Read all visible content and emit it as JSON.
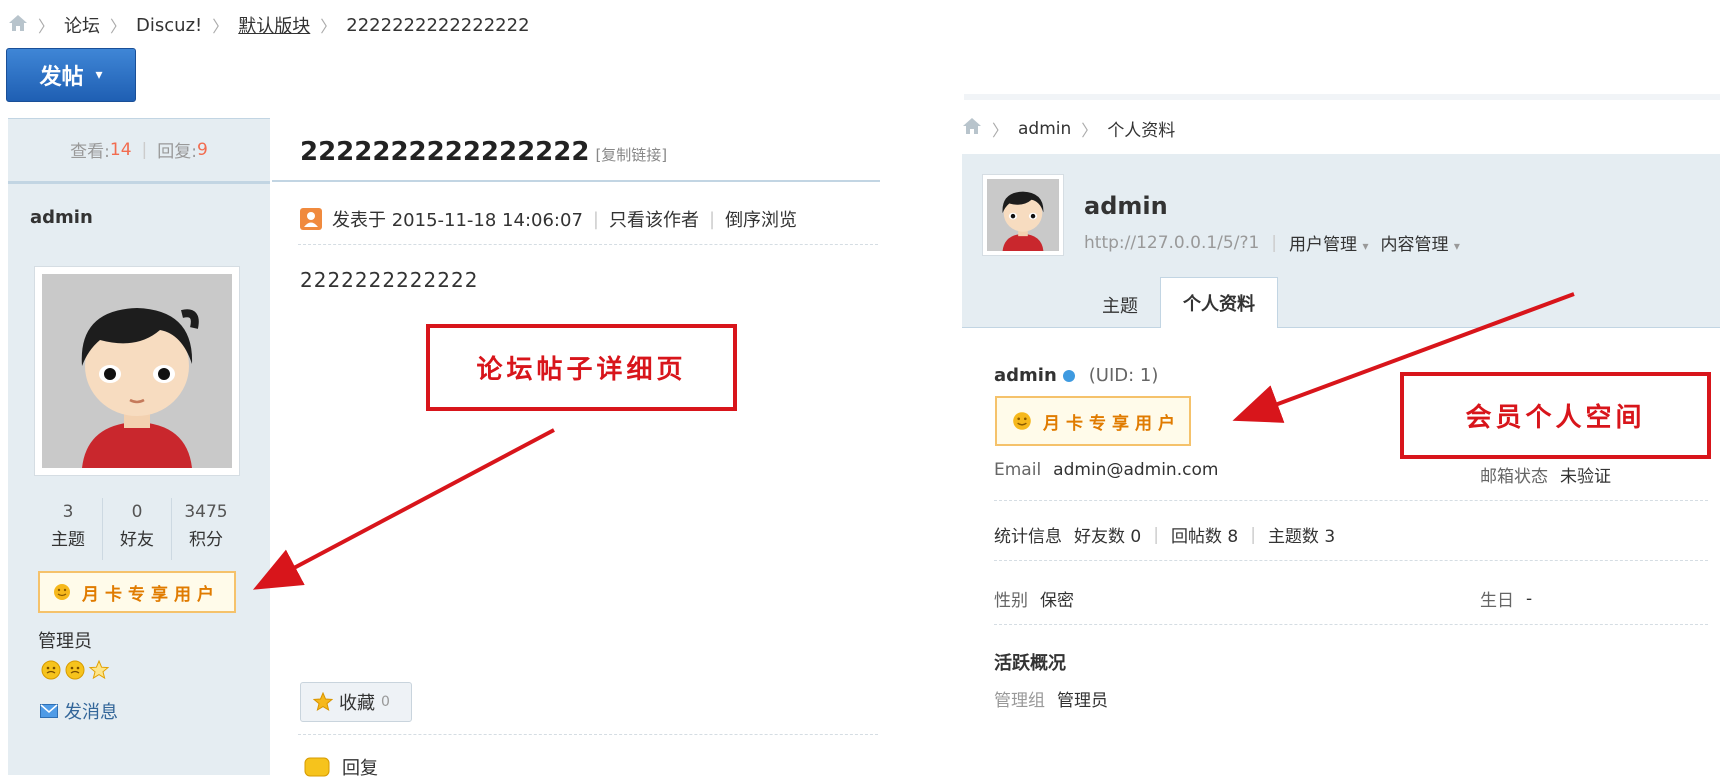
{
  "breadcrumb": {
    "items": [
      "论坛",
      "Discuz!",
      "默认版块",
      "2222222222222222"
    ]
  },
  "post_button": {
    "label": "发帖",
    "caret": "▾"
  },
  "sidebar": {
    "views_label": "查看:",
    "views": "14",
    "replies_label": "回复:",
    "replies": "9",
    "author": "admin",
    "counts": [
      {
        "value": "3",
        "label": "主题"
      },
      {
        "value": "0",
        "label": "好友"
      },
      {
        "value": "3475",
        "label": "积分"
      }
    ],
    "medal": "月卡专享用户",
    "group": "管理员",
    "send_message": "发消息"
  },
  "thread": {
    "title": "2222222222222222",
    "copy_link": "[复制链接]",
    "posted_at": "发表于 2015-11-18 14:06:07",
    "only_author": "只看该作者",
    "reverse": "倒序浏览",
    "body": "2222222222222",
    "favorite_label": "收藏",
    "favorite_count": "0",
    "reply_label": "回复"
  },
  "callouts": {
    "left": "论坛帖子详细页",
    "right": "会员个人空间"
  },
  "member_space": {
    "breadcrumb": [
      "admin",
      "个人资料"
    ],
    "name": "admin",
    "url": "http://127.0.0.1/5/?1",
    "user_manage": "用户管理",
    "content_manage": "内容管理",
    "tabs": [
      "主题",
      "个人资料"
    ],
    "username": "admin",
    "uid": "(UID: 1)",
    "medal": "月卡专享用户",
    "email_label": "Email",
    "email": "admin@admin.com",
    "email_status_label": "邮箱状态",
    "email_status": "未验证",
    "stats_label": "统计信息",
    "friends": "好友数 0",
    "replies": "回帖数 8",
    "threads": "主题数 3",
    "gender_label": "性别",
    "gender": "保密",
    "birthday_label": "生日",
    "birthday": "-",
    "activity_title": "活跃概况",
    "group_label": "管理组",
    "group": "管理员"
  },
  "colors": {
    "accent_blue": "#2a6fc4",
    "callout_red": "#d8151b",
    "medal_orange": "#e07b00",
    "panel_bg": "#e5edf2"
  }
}
